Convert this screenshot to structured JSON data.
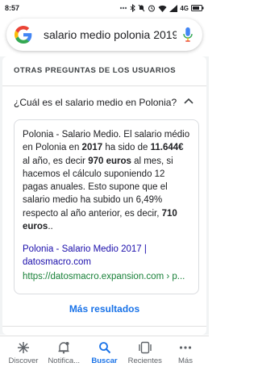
{
  "status_bar": {
    "time": "8:57",
    "network": "4G"
  },
  "search": {
    "query": "salario medio polonia 2019"
  },
  "card": {
    "title": "OTRAS PREGUNTAS DE LOS USUARIOS",
    "question": "¿Cuál es el salario medio en Polonia?",
    "answer": {
      "p1": "Polonia - Salario Medio. El salario médio en Polonia en ",
      "b1": "2017",
      "p2": " ha sido de ",
      "b2": "11.644€",
      "p3": " al año, es decir ",
      "b3": "970 euros",
      "p4": " al mes, si hacemos el cálculo suponiendo 12 pagas anuales. Esto supone que el salario medio ha subido un 6,49% respecto al año anterior, es decir, ",
      "b4": "710 euros",
      "p5": ".."
    },
    "source_title": "Polonia - Salario Medio 2017 | datosmacro.com",
    "source_url": "https://datosmacro.expansion.com › p...",
    "more_results": "Más resultados"
  },
  "bottom_nav": [
    {
      "label": "Discover",
      "icon": "asterisk-icon"
    },
    {
      "label": "Notifica...",
      "icon": "bell-icon"
    },
    {
      "label": "Buscar",
      "icon": "search-icon"
    },
    {
      "label": "Recientes",
      "icon": "tabs-icon"
    },
    {
      "label": "Más",
      "icon": "more-icon"
    }
  ],
  "colors": {
    "link": "#1a0dab",
    "url": "#188038",
    "accent": "#1a73e8"
  }
}
